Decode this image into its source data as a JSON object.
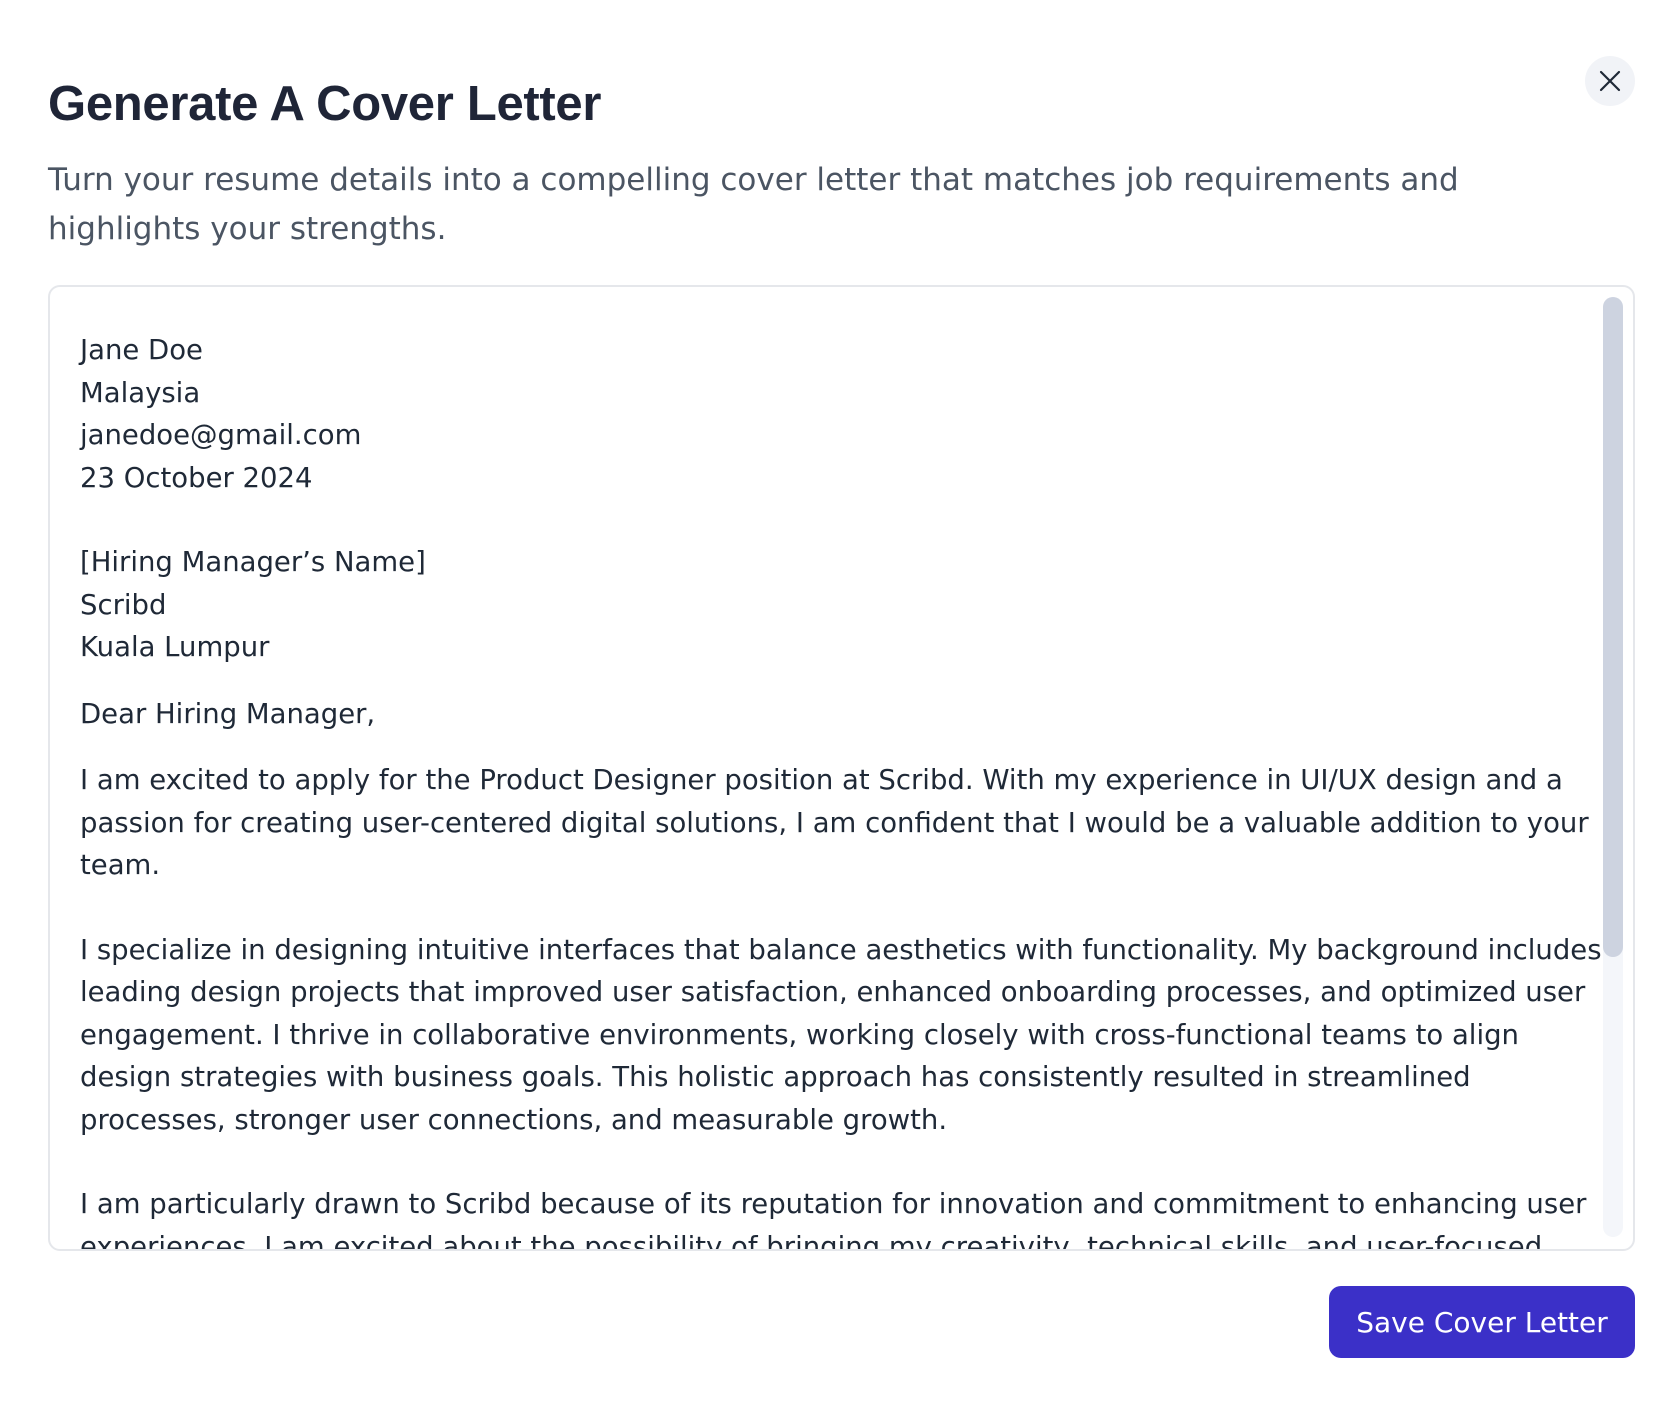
{
  "modal": {
    "title": "Generate A Cover Letter",
    "subtitle": "Turn your resume details into a compelling cover letter that matches job requirements and highlights your strengths.",
    "close_icon": "close-icon"
  },
  "letter": {
    "sender": {
      "name": "Jane Doe",
      "location": "Malaysia",
      "email": "janedoe@gmail.com",
      "date": "23 October 2024"
    },
    "recipient": {
      "name": "[Hiring Manager’s Name]",
      "company": "Scribd",
      "city": "Kuala Lumpur"
    },
    "salutation": "Dear Hiring Manager,",
    "paragraphs": [
      "I am excited to apply for the Product Designer position at Scribd. With my experience in UI/UX design and a passion for creating user-centered digital solutions, I am confident that I would be a valuable addition to your team.",
      "I specialize in designing intuitive interfaces that balance aesthetics with functionality. My background includes leading design projects that improved user satisfaction, enhanced onboarding processes, and optimized user engagement. I thrive in collaborative environments, working closely with cross-functional teams to align design strategies with business goals. This holistic approach has consistently resulted in streamlined processes, stronger user connections, and measurable growth.",
      "I am particularly drawn to Scribd because of its reputation for innovation and commitment to enhancing user experiences. I am excited about the possibility of bringing my creativity, technical skills, and user-focused mindset"
    ]
  },
  "actions": {
    "save_label": "Save Cover Letter"
  },
  "colors": {
    "primary": "#3b30c8",
    "title": "#1f2537",
    "text": "#1f2937",
    "muted": "#4b5563",
    "border": "#e5e7eb"
  }
}
